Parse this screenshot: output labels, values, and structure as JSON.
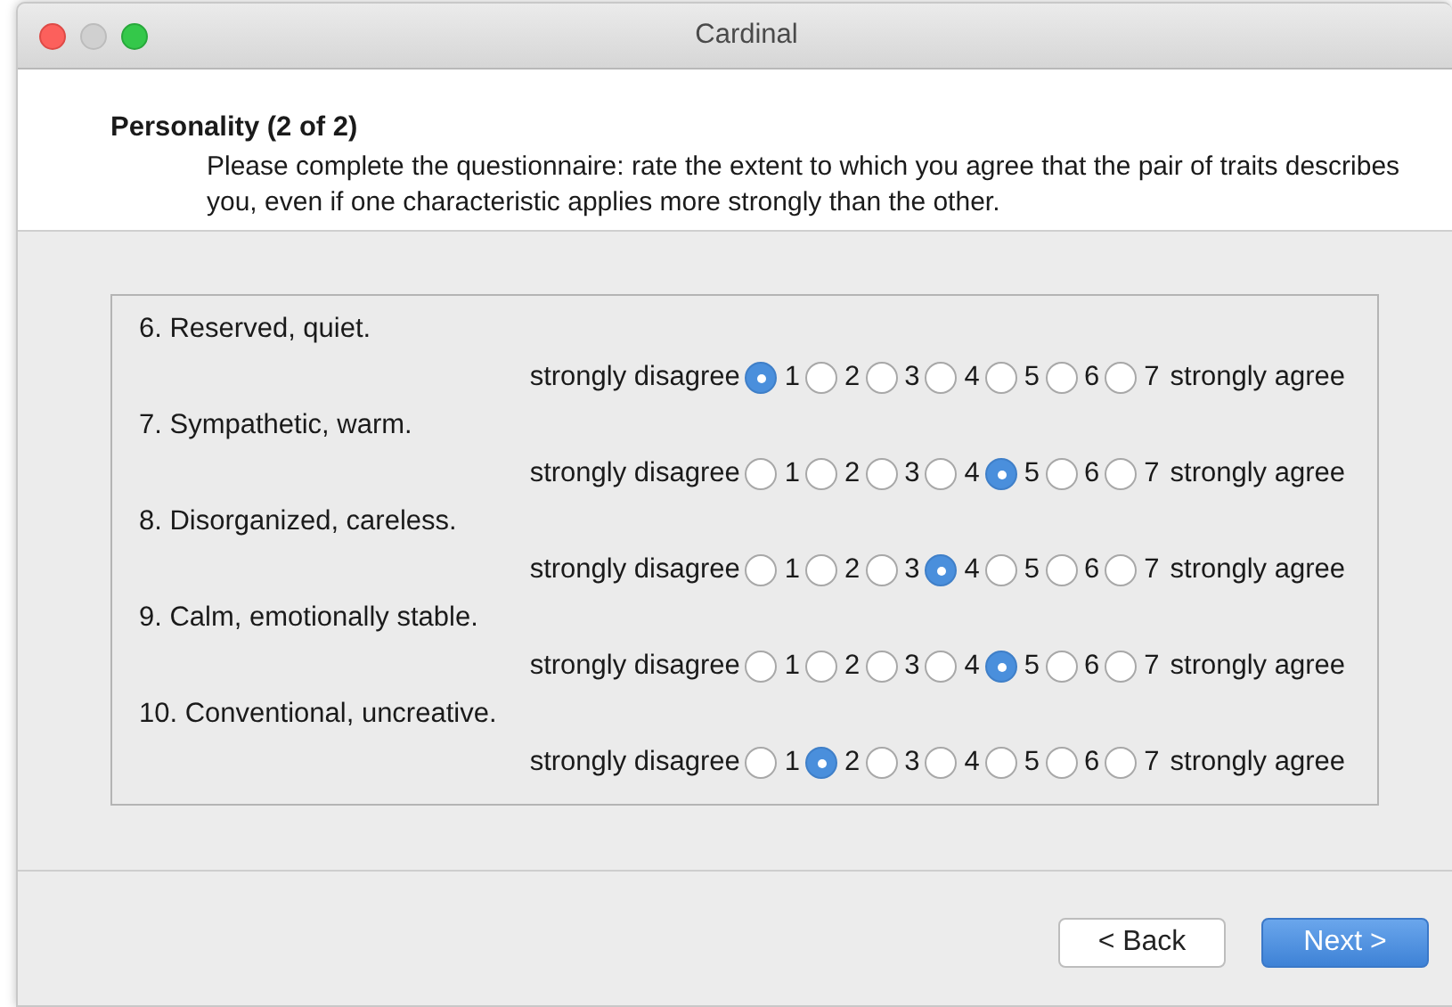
{
  "window": {
    "title": "Cardinal"
  },
  "header": {
    "title": "Personality (2 of 2)",
    "instructions": "Please complete the questionnaire: rate the extent to which you agree that the pair of traits describes you, even if one characteristic applies more strongly than the other."
  },
  "questions": [
    {
      "label": "6. Reserved, quiet.",
      "scale_low": "strongly disagree",
      "scale_high": "strongly agree",
      "options": [
        {
          "label": "1",
          "selected": true
        },
        {
          "label": "2",
          "selected": false
        },
        {
          "label": "3",
          "selected": false
        },
        {
          "label": "4",
          "selected": false
        },
        {
          "label": "5",
          "selected": false
        },
        {
          "label": "6",
          "selected": false
        },
        {
          "label": "7",
          "selected": false
        }
      ]
    },
    {
      "label": "7. Sympathetic, warm.",
      "scale_low": "strongly disagree",
      "scale_high": "strongly agree",
      "options": [
        {
          "label": "1",
          "selected": false
        },
        {
          "label": "2",
          "selected": false
        },
        {
          "label": "3",
          "selected": false
        },
        {
          "label": "4",
          "selected": false
        },
        {
          "label": "5",
          "selected": true
        },
        {
          "label": "6",
          "selected": false
        },
        {
          "label": "7",
          "selected": false
        }
      ]
    },
    {
      "label": "8. Disorganized, careless.",
      "scale_low": "strongly disagree",
      "scale_high": "strongly agree",
      "options": [
        {
          "label": "1",
          "selected": false
        },
        {
          "label": "2",
          "selected": false
        },
        {
          "label": "3",
          "selected": false
        },
        {
          "label": "4",
          "selected": true
        },
        {
          "label": "5",
          "selected": false
        },
        {
          "label": "6",
          "selected": false
        },
        {
          "label": "7",
          "selected": false
        }
      ]
    },
    {
      "label": "9. Calm, emotionally stable.",
      "scale_low": "strongly disagree",
      "scale_high": "strongly agree",
      "options": [
        {
          "label": "1",
          "selected": false
        },
        {
          "label": "2",
          "selected": false
        },
        {
          "label": "3",
          "selected": false
        },
        {
          "label": "4",
          "selected": false
        },
        {
          "label": "5",
          "selected": true
        },
        {
          "label": "6",
          "selected": false
        },
        {
          "label": "7",
          "selected": false
        }
      ]
    },
    {
      "label": "10. Conventional, uncreative.",
      "scale_low": "strongly disagree",
      "scale_high": "strongly agree",
      "options": [
        {
          "label": "1",
          "selected": false
        },
        {
          "label": "2",
          "selected": true
        },
        {
          "label": "3",
          "selected": false
        },
        {
          "label": "4",
          "selected": false
        },
        {
          "label": "5",
          "selected": false
        },
        {
          "label": "6",
          "selected": false
        },
        {
          "label": "7",
          "selected": false
        }
      ]
    }
  ],
  "buttons": [
    {
      "label": "< Back",
      "primary": false
    },
    {
      "label": "Next >",
      "primary": true
    }
  ]
}
